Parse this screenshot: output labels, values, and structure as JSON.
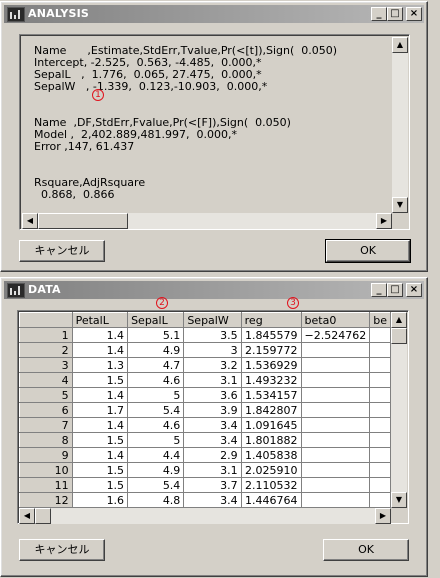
{
  "analysis_window": {
    "title": "ANALYSIS",
    "lines": [
      "Name      ,Estimate,StdErr,Tvalue,Pr(<[t]),Sign(  0.050)",
      "Intercept, -2.525,  0.563, -4.485,  0.000,*",
      "SepalL   ,  1.776,  0.065, 27.475,  0.000,*",
      "SepalW   , -1.339,  0.123,-10.903,  0.000,*",
      "",
      "",
      "Name  ,DF,StdErr,Fvalue,Pr(<[F]),Sign(  0.050)",
      "Model ,  2,402.889,481.997,  0.000,*",
      "Error ,147, 61.437",
      "",
      "",
      "Rsquare,AdjRsquare",
      "  0.868,  0.866"
    ],
    "marker": "1",
    "cancel_label": "キャンセル",
    "ok_label": "OK"
  },
  "data_window": {
    "title": "DATA",
    "col_markers": [
      "2",
      "3"
    ],
    "columns": [
      "",
      "PetalL",
      "SepalL",
      "SepalW",
      "reg",
      "beta0",
      "be"
    ],
    "rows": [
      [
        "1",
        "1.4",
        "5.1",
        "3.5",
        "1.845579",
        "−2.524762",
        ""
      ],
      [
        "2",
        "1.4",
        "4.9",
        "3",
        "2.159772",
        "",
        ""
      ],
      [
        "3",
        "1.3",
        "4.7",
        "3.2",
        "1.536929",
        "",
        ""
      ],
      [
        "4",
        "1.5",
        "4.6",
        "3.1",
        "1.493232",
        "",
        ""
      ],
      [
        "5",
        "1.4",
        "5",
        "3.6",
        "1.534157",
        "",
        ""
      ],
      [
        "6",
        "1.7",
        "5.4",
        "3.9",
        "1.842807",
        "",
        ""
      ],
      [
        "7",
        "1.4",
        "4.6",
        "3.4",
        "1.091645",
        "",
        ""
      ],
      [
        "8",
        "1.5",
        "5",
        "3.4",
        "1.801882",
        "",
        ""
      ],
      [
        "9",
        "1.4",
        "4.4",
        "2.9",
        "1.405838",
        "",
        ""
      ],
      [
        "10",
        "1.5",
        "4.9",
        "3.1",
        "2.025910",
        "",
        ""
      ],
      [
        "11",
        "1.5",
        "5.4",
        "3.7",
        "2.110532",
        "",
        ""
      ],
      [
        "12",
        "1.6",
        "4.8",
        "3.4",
        "1.446764",
        "",
        ""
      ]
    ],
    "cancel_label": "キャンセル",
    "ok_label": "OK"
  },
  "colors": {
    "titlebar_inactive": "#808080",
    "marker_red": "#e0141e",
    "face": "#d4d0c8"
  }
}
